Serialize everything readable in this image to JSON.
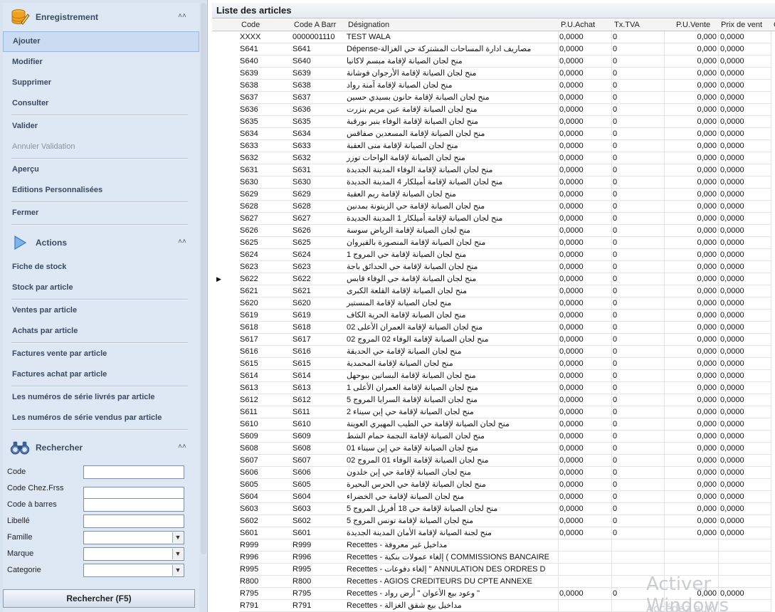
{
  "sidebar": {
    "enregistrement": {
      "title": "Enregistrement",
      "items": [
        "Ajouter",
        "Modifier",
        "Supprimer",
        "Consulter",
        "Valider",
        "Annuler Validation",
        "Aperçu",
        "Editions Personnalisées",
        "Fermer"
      ]
    },
    "actions": {
      "title": "Actions",
      "items": [
        "Fiche de stock",
        "Stock par article",
        "Ventes par article",
        "Achats par article",
        "Factures vente par article",
        "Factures achat par article",
        "Les numéros de série livrés par article",
        "Les numéros de série vendus par article"
      ]
    },
    "rechercher": {
      "title": "Rechercher",
      "fields": [
        "Code",
        "Code Chez.Frss",
        "Code à barres",
        "Libellé",
        "Famille",
        "Marque",
        "Categorie"
      ],
      "button": "Rechercher (F5)"
    }
  },
  "main": {
    "title": "Liste des articles",
    "columns": [
      "Code",
      "Code A Barr",
      "Désignation",
      "P.U.Achat",
      "Tx.TVA",
      "P.U.Vente",
      "Prix de vent",
      "C"
    ],
    "rows": [
      [
        "XXXX",
        "0000001110",
        "TEST WALA",
        "0,0000",
        "0",
        "0,000",
        "0,0000"
      ],
      [
        "S641",
        "S641",
        "Dépense-مصاريف ادارة المساحات المشتركة حي الغزالة",
        "0,0000",
        "0",
        "0,000",
        "0,0000"
      ],
      [
        "S640",
        "S640",
        "منح لجان الصيانة لإقامة مبسم لاكانيا",
        "0,0000",
        "0",
        "0,000",
        "0,0000"
      ],
      [
        "S639",
        "S639",
        "منح لجان الصيانة لإقامة الأرجوان فوشانة",
        "0,0000",
        "0",
        "0,000",
        "0,0000"
      ],
      [
        "S638",
        "S638",
        "منح لجان الصيانة لإقامة آمنة رواد",
        "0,0000",
        "0",
        "0,000",
        "0,0000"
      ],
      [
        "S637",
        "S637",
        "منح لجان الصيانة لإقامة حانون بسيدي حسين",
        "0,0000",
        "0",
        "0,000",
        "0,0000"
      ],
      [
        "S636",
        "S636",
        "منح لجان الصيانة لإقامة عين مريم بنزرت",
        "0,0000",
        "0",
        "0,000",
        "0,0000"
      ],
      [
        "S635",
        "S635",
        "منح لجان الصيانة لإقامة الوفاء بنبر بورقبة",
        "0,0000",
        "0",
        "0,000",
        "0,0000"
      ],
      [
        "S634",
        "S634",
        "منح لجان الصيانة لإقامة المسعدين صفاقس",
        "0,0000",
        "0",
        "0,000",
        "0,0000"
      ],
      [
        "S633",
        "S633",
        "منح لجان الصيانة لإقامة منى العقبة",
        "0,0000",
        "0",
        "0,000",
        "0,0000"
      ],
      [
        "S632",
        "S632",
        "منح لجان الصيانة لإقامة الواحات توزر",
        "0,0000",
        "0",
        "0,000",
        "0,0000"
      ],
      [
        "S631",
        "S631",
        "منح لجان الصيانة لإقامة الوفاء المدينة الجديدة",
        "0,0000",
        "0",
        "0,000",
        "0,0000"
      ],
      [
        "S630",
        "S630",
        "منح لجان الصيانة لإقامة أميلكار 4 المدينة الجديدة",
        "0,0000",
        "0",
        "0,000",
        "0,0000"
      ],
      [
        "S629",
        "S629",
        "منح لجان الصيانة لإقامة ريم العقبة",
        "0,0000",
        "0",
        "0,000",
        "0,0000"
      ],
      [
        "S628",
        "S628",
        "منح لجان الصيانة لإقامة حي الزيتونة بمدنين",
        "0,0000",
        "0",
        "0,000",
        "0,0000"
      ],
      [
        "S627",
        "S627",
        "منح لجان الصيانة لإقامة أميلكار 1 المدينة الجديدة",
        "0,0000",
        "0",
        "0,000",
        "0,0000"
      ],
      [
        "S626",
        "S626",
        "منح لجان الصيانة لإقامة الرياض سوسة",
        "0,0000",
        "0",
        "0,000",
        "0,0000"
      ],
      [
        "S625",
        "S625",
        "منح لجان الصيانة لإقامة المنصورة بالقيروان",
        "0,0000",
        "0",
        "0,000",
        "0,0000"
      ],
      [
        "S624",
        "S624",
        "منح لجان الصيانة لإقامة حي المروج 1",
        "0,0000",
        "0",
        "0,000",
        "0,0000"
      ],
      [
        "S623",
        "S623",
        "منح لجان الصيانة لإقامة حي الحدائق باجة",
        "0,0000",
        "0",
        "0,000",
        "0,0000"
      ],
      [
        "S622",
        "S622",
        "منح لجان الصيانة لإقامة حي الوفاء قابس",
        "0,0000",
        "0",
        "0,000",
        "0,0000"
      ],
      [
        "S621",
        "S621",
        "منح لجان الصيانة لإقامة القلعة الكبرى",
        "0,0000",
        "0",
        "0,000",
        "0,0000"
      ],
      [
        "S620",
        "S620",
        "منح لجان الصيانة لإقامة المنستير",
        "0,0000",
        "0",
        "0,000",
        "0,0000"
      ],
      [
        "S619",
        "S619",
        "منح لجان الصيانة لإقامة الحرية الكاف",
        "0,0000",
        "0",
        "0,000",
        "0,0000"
      ],
      [
        "S618",
        "S618",
        "منح لجان الصيانة لإقامة العمران الأعلى 02",
        "0,0000",
        "0",
        "0,000",
        "0,0000"
      ],
      [
        "S617",
        "S617",
        "منح لجان الصيانة لإقامة الوفاء 02 المروج 02",
        "0,0000",
        "0",
        "0,000",
        "0,0000"
      ],
      [
        "S616",
        "S616",
        "منح لجان الصيانة لإقامة حي الحديقة",
        "0,0000",
        "0",
        "0,000",
        "0,0000"
      ],
      [
        "S615",
        "S615",
        "منح لجان الصيانة لإقامة المحمدية",
        "0,0000",
        "0",
        "0,000",
        "0,0000"
      ],
      [
        "S614",
        "S614",
        "منح لجان الصيانة لإقامة البساتين ببوحهل",
        "0,0000",
        "0",
        "0,000",
        "0,0000"
      ],
      [
        "S613",
        "S613",
        "منح لجان الصيانة لإقامة العمران الأعلى 1",
        "0,0000",
        "0",
        "0,000",
        "0,0000"
      ],
      [
        "S612",
        "S612",
        "منح لجان الصيانة لإقامة السرايا المروج 5",
        "0,0000",
        "0",
        "0,000",
        "0,0000"
      ],
      [
        "S611",
        "S611",
        "منح لجان الصيانة لإقامة حي إبن سيناء 2",
        "0,0000",
        "0",
        "0,000",
        "0,0000"
      ],
      [
        "S610",
        "S610",
        "منح لجان الصيانة لإقامة حي الطيب المهيري العوينة",
        "0,0000",
        "0",
        "0,000",
        "0,0000"
      ],
      [
        "S609",
        "S609",
        "منح لجان الصيانة لإقامة النجمة حمام الشط",
        "0,0000",
        "0",
        "0,000",
        "0,0000"
      ],
      [
        "S608",
        "S608",
        "منح لجان الصيانة لإقامة حي إبن سيناء 01",
        "0,0000",
        "0",
        "0,000",
        "0,0000"
      ],
      [
        "S607",
        "S607",
        "منح لجان الصيانة لإقامة الوفاء 01 المروج 02",
        "0,0000",
        "0",
        "0,000",
        "0,0000"
      ],
      [
        "S606",
        "S606",
        "منح لجان الصيانة لإقامة حي إبن خلدون",
        "0,0000",
        "0",
        "0,000",
        "0,0000"
      ],
      [
        "S605",
        "S605",
        "منح لجان الصيانة لإقامة حي الحرس البحيرة",
        "0,0000",
        "0",
        "0,000",
        "0,0000"
      ],
      [
        "S604",
        "S604",
        "منح لجان الصيانة لإقامة حي الخضراء",
        "0,0000",
        "0",
        "0,000",
        "0,0000"
      ],
      [
        "S603",
        "S603",
        "منح لجان الصيانة لإقامة حي 18 أفريل المروج 5",
        "0,0000",
        "0",
        "0,000",
        "0,0000"
      ],
      [
        "S602",
        "S602",
        "منح لجان الصيانة لإقامة تونس المروج 5",
        "0,0000",
        "0",
        "0,000",
        "0,0000"
      ],
      [
        "S601",
        "S601",
        "منح لجنة الصيانة لإقامة الأمان المدينة الجديدة",
        "0,0000",
        "0",
        "0,000",
        "0,0000"
      ],
      [
        "R999",
        "R999",
        "Recettes - مداخيل غير معروفة",
        "",
        "",
        "",
        ""
      ],
      [
        "R996",
        "R996",
        "Recettes - إلغاء عمولات بنكية ( COMMISSIONS BANCAIRE",
        "",
        "",
        "",
        ""
      ],
      [
        "R995",
        "R995",
        "Recettes - إلغاء دفوعات \" ANNULATION DES ORDRES D",
        "",
        "",
        "",
        ""
      ],
      [
        "R800",
        "R800",
        "Recettes - AGIOS CREDITEURS DU CPTE ANNEXE",
        "",
        "",
        "",
        ""
      ],
      [
        "R795",
        "R795",
        "Recettes - وعود بيع الأعوان \" أرض رواد \"",
        "0,0000",
        "0",
        "0,000",
        "0,0000"
      ],
      [
        "R791",
        "R791",
        "Recettes - مداخيل بيع شقق الغزالة",
        "",
        "",
        "",
        ""
      ]
    ]
  },
  "watermark": {
    "line1": "Activer Windows",
    "line2": "Accédez aux paramètres"
  }
}
